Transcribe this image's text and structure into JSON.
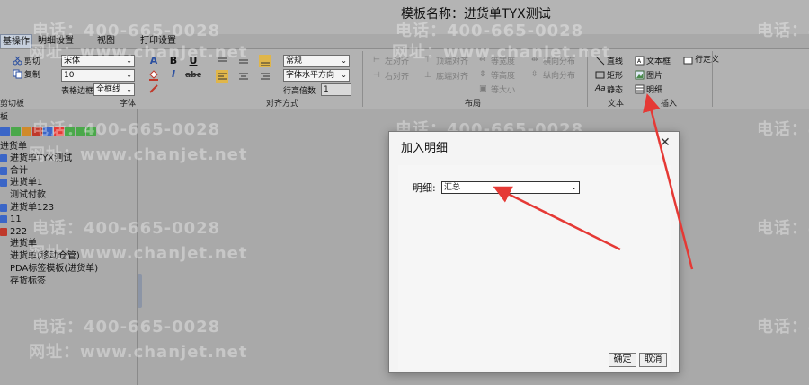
{
  "window": {
    "title": "模板名称：进货单TYX测试"
  },
  "tabs": [
    "基操作",
    "明细设置",
    "视图",
    "打印设置"
  ],
  "ribbon": {
    "clipboard": {
      "cut": "剪切",
      "copy": "复制",
      "label": "剪切板"
    },
    "font": {
      "family": "宋体",
      "size": "10",
      "border_label": "表格边框",
      "border_value": "全框线",
      "label": "字体",
      "bold": "B",
      "underline": "U",
      "strike": "abc",
      "font_a": "A",
      "italic": "I"
    },
    "align": {
      "style": "常规",
      "horizontal": "字体水平方向",
      "line_height_label": "行高倍数",
      "line_height_value": "1",
      "label": "对齐方式"
    },
    "layout": {
      "left": "左对齐",
      "right": "右对齐",
      "top": "顶端对齐",
      "bottom": "底端对齐",
      "same_width": "等宽度",
      "same_height": "等高度",
      "same_size": "等大小",
      "h_dist": "横向分布",
      "v_dist": "纵向分布",
      "label": "布局"
    },
    "text": {
      "line": "直线",
      "rect": "矩形",
      "static": "静态",
      "label": "文本"
    },
    "insert": {
      "textbox": "文本框",
      "image": "图片",
      "detail": "明细",
      "row_def": "行定义",
      "label": "插入"
    }
  },
  "left_panel": {
    "title": "板",
    "group": "进货单",
    "items": [
      "进货单TYX测试",
      "合计",
      "进货单1",
      "测试付款",
      "进货单123",
      "11",
      "222",
      "进货单",
      "进货单(移动仓管)",
      "PDA标签模板(进货单)",
      "存货标签"
    ]
  },
  "watermark": {
    "phone": "电话：400-665-0028",
    "site": "网址：www.chanjet.net"
  },
  "dialog": {
    "title": "加入明细",
    "close": "✕",
    "detail_label": "明细:",
    "detail_value": "汇总",
    "ok": "确定",
    "cancel": "取消"
  },
  "colors": {
    "annotation_arrow": "#e53935",
    "accent": "#3b66c7"
  }
}
